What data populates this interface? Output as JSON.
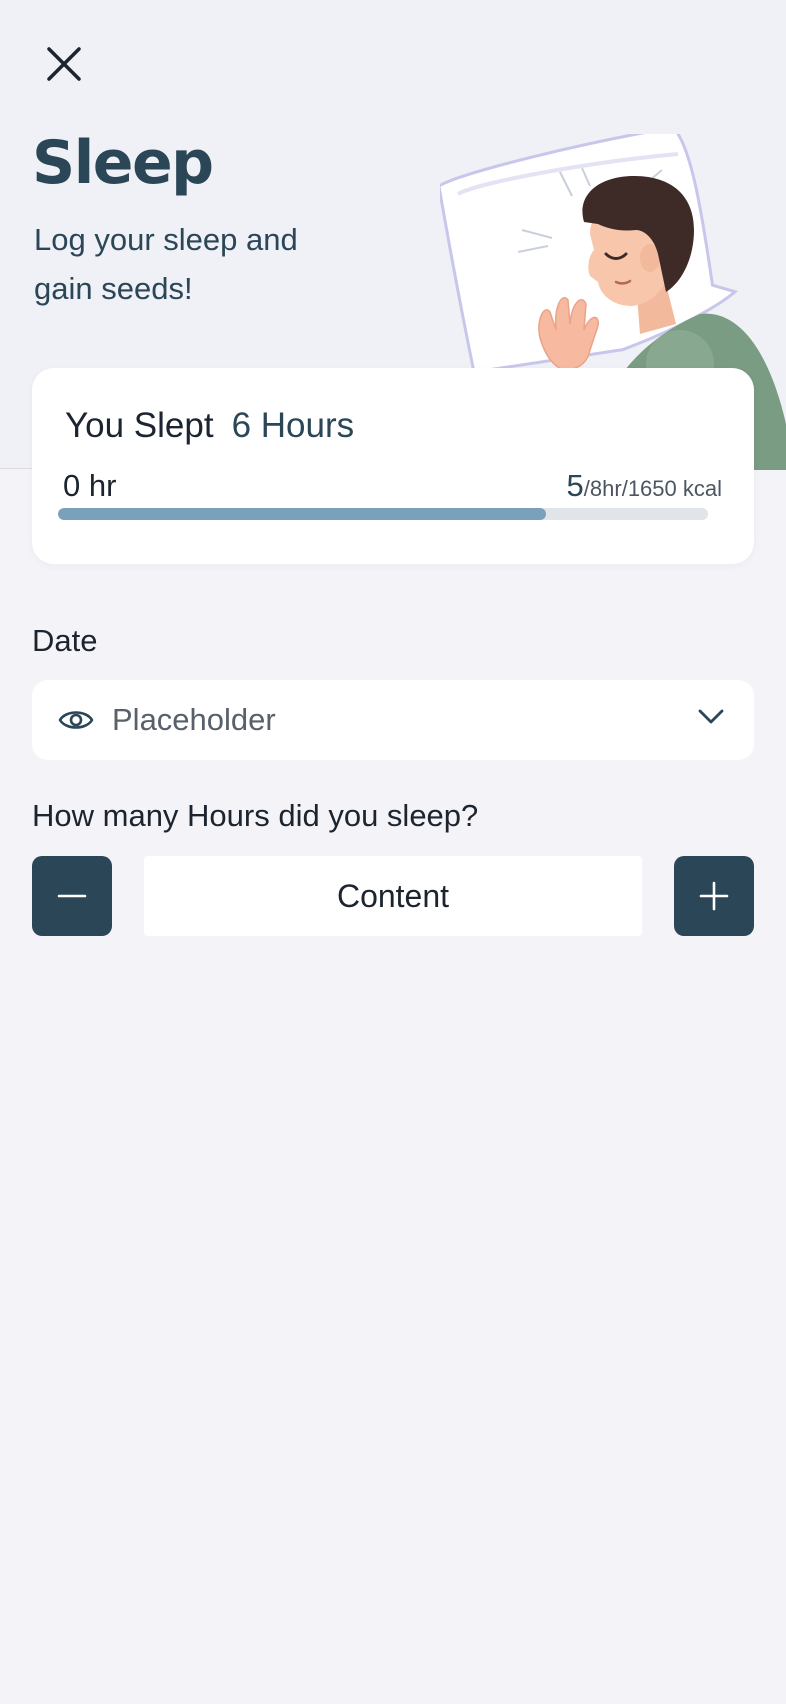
{
  "header": {
    "title": "Sleep",
    "subtitle": "Log your sleep and gain seeds!",
    "illustration_icon": "sleeping-man-illustration",
    "close_icon": "close-icon"
  },
  "summary": {
    "slept_label": "You Slept",
    "slept_value": "6 Hours",
    "range_start": "0 hr",
    "range_end_value": "5",
    "range_end_suffix": "/8hr/1650 kcal",
    "progress_fraction": 0.75
  },
  "form": {
    "date_label": "Date",
    "date_placeholder": "Placeholder",
    "date_icon": "eye-icon",
    "dropdown_icon": "chevron-down-icon",
    "hours_label": "How many Hours did you sleep?",
    "hours_value": "Content",
    "minus_icon": "minus-icon",
    "plus_icon": "plus-icon"
  },
  "colors": {
    "primary": "#2b4657",
    "progress": "#7aa1b9",
    "background": "#f4f4f8",
    "header_background": "#eff1f6"
  }
}
